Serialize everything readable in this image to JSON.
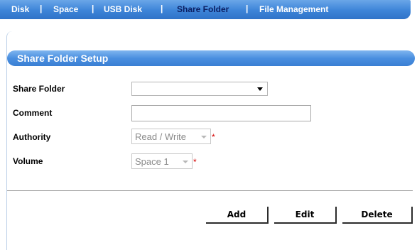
{
  "tabs": [
    {
      "label": "Disk",
      "active": false
    },
    {
      "label": "Space",
      "active": false
    },
    {
      "label": "USB Disk",
      "active": false
    },
    {
      "label": "Share Folder",
      "active": true
    },
    {
      "label": "File Management",
      "active": false
    }
  ],
  "separator": "|",
  "panel": {
    "title": "Share Folder Setup"
  },
  "form": {
    "share_folder": {
      "label": "Share Folder",
      "value": ""
    },
    "comment": {
      "label": "Comment",
      "value": ""
    },
    "authority": {
      "label": "Authority",
      "value": "Read / Write",
      "required_mark": "*"
    },
    "volume": {
      "label": "Volume",
      "value": "Space 1",
      "required_mark": "*"
    }
  },
  "buttons": {
    "add": "Add",
    "edit": "Edit",
    "delete": "Delete"
  },
  "colors": {
    "tab_bar": "#3d84d8",
    "active_tab_text": "#0b1f63",
    "header_bar": "#4a8fe0",
    "required": "#d40000"
  }
}
